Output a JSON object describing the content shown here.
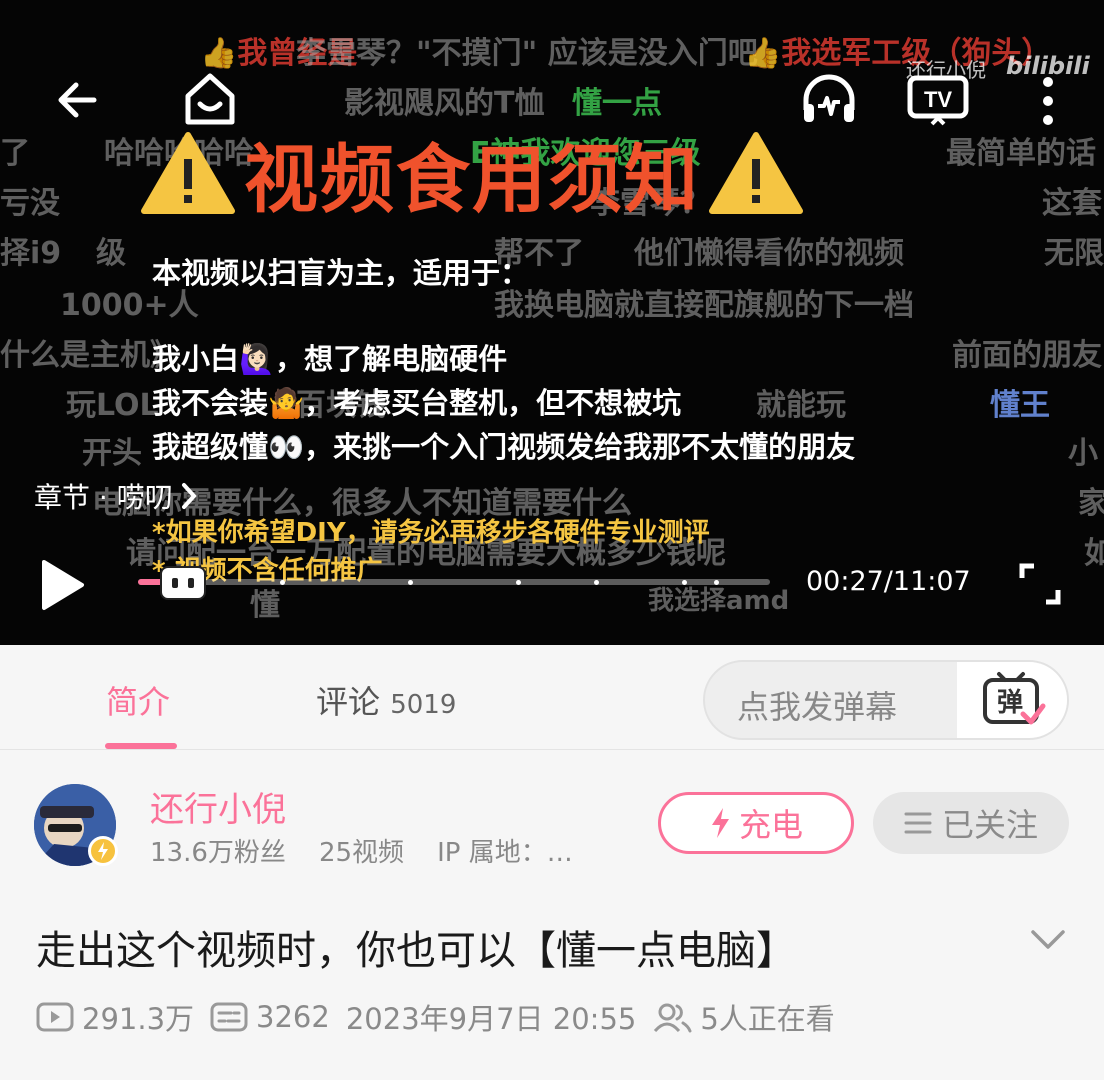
{
  "danmaku": [
    {
      "text": "👍我曾经是",
      "cls": "red"
    },
    {
      "text": "李雪琴？\"不摸门\" 应该是没入门吧",
      "cls": ""
    },
    {
      "text": "👍我选军工级（狗头）",
      "cls": "red"
    },
    {
      "text": "影视飓风的T恤",
      "cls": ""
    },
    {
      "text": "懂一点",
      "cls": "green"
    },
    {
      "text": "了",
      "cls": ""
    },
    {
      "text": "哈哈哈哈哈",
      "cls": ""
    },
    {
      "text": "E神我欢迎您三级",
      "cls": "green"
    },
    {
      "text": "最简单的话",
      "cls": ""
    },
    {
      "text": "李雪琴？",
      "cls": ""
    },
    {
      "text": "亏没",
      "cls": ""
    },
    {
      "text": "这套",
      "cls": ""
    },
    {
      "text": "择i9",
      "cls": ""
    },
    {
      "text": "级",
      "cls": ""
    },
    {
      "text": "帮不了",
      "cls": ""
    },
    {
      "text": "他们懒得看你的视频",
      "cls": ""
    },
    {
      "text": "无限",
      "cls": ""
    },
    {
      "text": "1000+人",
      "cls": ""
    },
    {
      "text": "我换电脑就直接配旗舰的下一档",
      "cls": ""
    },
    {
      "text": "什么是主机》",
      "cls": ""
    },
    {
      "text": "前面的朋友",
      "cls": ""
    },
    {
      "text": "玩LOL",
      "cls": ""
    },
    {
      "text": "百块钱",
      "cls": ""
    },
    {
      "text": "就能玩",
      "cls": ""
    },
    {
      "text": "懂王",
      "cls": "blue"
    },
    {
      "text": "开头",
      "cls": ""
    },
    {
      "text": "小",
      "cls": ""
    },
    {
      "text": "电脑你需要什么，很多人不知道需要什么",
      "cls": ""
    },
    {
      "text": "家",
      "cls": ""
    },
    {
      "text": "请问配一台一万配置的电脑需要大概多少钱呢",
      "cls": ""
    },
    {
      "text": "如",
      "cls": ""
    },
    {
      "text": "懂",
      "cls": ""
    },
    {
      "text": "我选择amd",
      "cls": ""
    }
  ],
  "video": {
    "watermark_user": "还行小倪",
    "watermark_logo": "bilibili",
    "title": "视频食用须知",
    "intro": "本视频以扫盲为主，适用于：",
    "line1": "我小白🙋🏻‍♀️，想了解电脑硬件",
    "line2": "我不会装🤷，考虑买台整机，但不想被坑",
    "line3": "我超级懂👀，来挑一个入门视频发给我那不太懂的朋友",
    "note1": "*如果你希望DIY，请务必再移步各硬件专业测评",
    "note2": "* 视频不含任何推广",
    "chapter": "章节 · 唠叨",
    "time": "00:27/11:07",
    "progress": 0.04
  },
  "tabs": {
    "intro": "简介",
    "comments": "评论",
    "comments_count": "5019"
  },
  "danmaku_input": {
    "placeholder": "点我发弹幕",
    "button": "弹"
  },
  "uploader": {
    "name": "还行小倪",
    "fans": "13.6万粉丝",
    "videos": "25视频",
    "ip": "IP 属地：…",
    "charge": "充电",
    "followed": "已关注"
  },
  "title": "走出这个视频时，你也可以【懂一点电脑】",
  "stats": {
    "views": "291.3万",
    "danmaku": "3262",
    "date": "2023年9月7日 20:55",
    "watching": "5人正在看"
  },
  "colors": {
    "accent": "#fb7299",
    "warning_title": "#f0522c",
    "warning_yellow": "#f5c542"
  }
}
